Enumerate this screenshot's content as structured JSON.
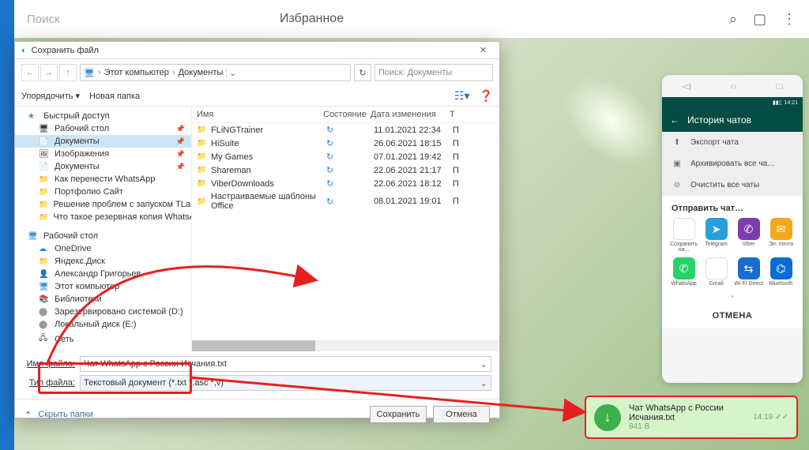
{
  "topbar": {
    "search": "Поиск",
    "favorites": "Избранное"
  },
  "phone": {
    "header": "История чатов",
    "menu": [
      {
        "icon": "⬆",
        "label": "Экспорт чата"
      },
      {
        "icon": "▣",
        "label": "Архивировать все ча…"
      },
      {
        "icon": "⊘",
        "label": "Очистить все чаты"
      }
    ],
    "share_title": "Отправить чат…",
    "apps": [
      {
        "label": "Сохранить на...",
        "cls": "ic-drive",
        "glyph": "▲"
      },
      {
        "label": "Telegram",
        "cls": "ic-tg",
        "glyph": "➤"
      },
      {
        "label": "Viber",
        "cls": "ic-viber",
        "glyph": "✆"
      },
      {
        "label": "Эл. почта",
        "cls": "ic-mail",
        "glyph": "✉"
      },
      {
        "label": "WhatsApp",
        "cls": "ic-wa",
        "glyph": "✆"
      },
      {
        "label": "Gmail",
        "cls": "ic-gmail",
        "glyph": "M"
      },
      {
        "label": "Wi-Fi Direct",
        "cls": "ic-wifi",
        "glyph": "⇆"
      },
      {
        "label": "Bluetooth",
        "cls": "ic-bt",
        "glyph": "⌬"
      }
    ],
    "cancel": "ОТМЕНА",
    "time": "14:21"
  },
  "download": {
    "name": "Чат WhatsApp с России Исчания.txt",
    "size": "841 B",
    "time": "14:19"
  },
  "dialog": {
    "title": "Сохранить файл",
    "crumbs": [
      "Этот компьютер",
      "Документы"
    ],
    "search_placeholder": "Поиск: Документы",
    "organize": "Упорядочить",
    "new_folder": "Новая папка",
    "cols": {
      "name": "Имя",
      "state": "Состояние",
      "date": "Дата изменения",
      "type": "Т"
    },
    "nav_quick": "Быстрый доступ",
    "nav_quick_items": [
      "Рабочий стол",
      "Документы",
      "Изображения",
      "Документы",
      "Как перенести WhatsApp",
      "Портфолио Сайт",
      "Решение проблем с запуском TLauncher",
      "Что такое резервная копия WhatsApp"
    ],
    "nav_desktop": "Рабочий стол",
    "nav_desktop_items": [
      "OneDrive",
      "Яндекс.Диск",
      "Александр Григорьев",
      "Этот компьютер",
      "Библиотеки",
      "Зарезервировано системой (D:)",
      "Локальный диск (E:)",
      "Сеть"
    ],
    "files": [
      {
        "name": "FLiNGTrainer",
        "date": "11.01.2021 22:34",
        "type": "П"
      },
      {
        "name": "HiSuite",
        "date": "26.06.2021 18:15",
        "type": "П"
      },
      {
        "name": "My Games",
        "date": "07.01.2021 19:42",
        "type": "П"
      },
      {
        "name": "Shareman",
        "date": "22.06.2021 21:17",
        "type": "П"
      },
      {
        "name": "ViberDownloads",
        "date": "22.06.2021 18:12",
        "type": "П"
      },
      {
        "name": "Настраиваемые шаблоны Office",
        "date": "08.01.2021 19:01",
        "type": "П"
      }
    ],
    "filename_label": "Имя файла:",
    "filetype_label": "Тип файла:",
    "filename_value": "Чат WhatsApp с России Исчания.txt",
    "filetype_value": "Текстовый документ (*.txt *.asc *,v)",
    "hide_folders": "Скрыть папки",
    "save": "Сохранить",
    "cancel": "Отмена"
  }
}
